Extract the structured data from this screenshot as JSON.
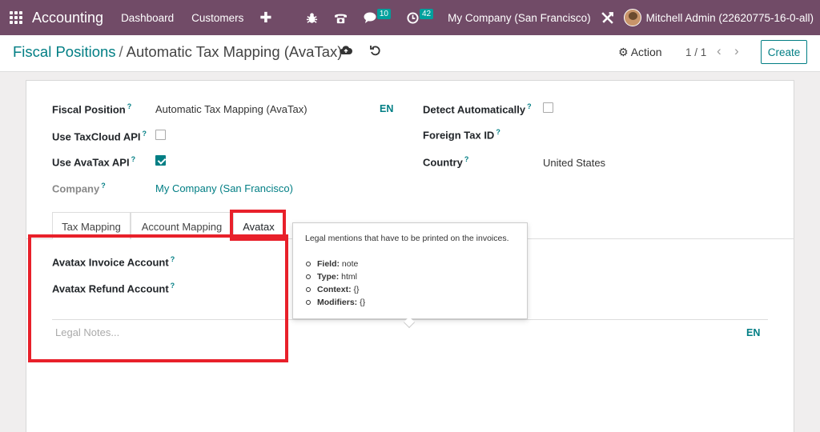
{
  "navbar": {
    "app_name": "Accounting",
    "menu": [
      "Dashboard",
      "Customers"
    ],
    "chat_count": "10",
    "activity_count": "42",
    "company": "My Company (San Francisco)",
    "user": "Mitchell Admin (22620775-16-0-all)",
    "color": "#714b67"
  },
  "control": {
    "breadcrumb_parent": "Fiscal Positions",
    "breadcrumb_sep": "/",
    "breadcrumb_current": "Automatic Tax Mapping (AvaTax)",
    "action_label": "Action",
    "pager": "1 / 1",
    "create_label": "Create"
  },
  "form": {
    "fiscal_position_label": "Fiscal Position",
    "fiscal_position_value": "Automatic Tax Mapping (AvaTax)",
    "lang_label": "EN",
    "use_taxcloud_label": "Use TaxCloud API",
    "use_taxcloud_checked": false,
    "use_avatax_label": "Use AvaTax API",
    "use_avatax_checked": true,
    "company_label": "Company",
    "company_value": "My Company (San Francisco)",
    "detect_auto_label": "Detect Automatically",
    "detect_auto_checked": false,
    "foreign_tax_label": "Foreign Tax ID",
    "country_label": "Country",
    "country_value": "United States",
    "help_mark": "?"
  },
  "tabs": [
    "Tax Mapping",
    "Account Mapping",
    "Avatax"
  ],
  "avatax_tab": {
    "invoice_account_label": "Avatax Invoice Account",
    "refund_account_label": "Avatax Refund Account",
    "notes_placeholder": "Legal Notes...",
    "notes_lang": "EN"
  },
  "tooltip": {
    "help": "Legal mentions that have to be printed on the invoices.",
    "items": [
      {
        "key": "Field:",
        "value": "note"
      },
      {
        "key": "Type:",
        "value": "html"
      },
      {
        "key": "Context:",
        "value": "{}"
      },
      {
        "key": "Modifiers:",
        "value": "{}"
      }
    ]
  },
  "colors": {
    "accent": "#017e84",
    "highlight": "#e8202a"
  }
}
